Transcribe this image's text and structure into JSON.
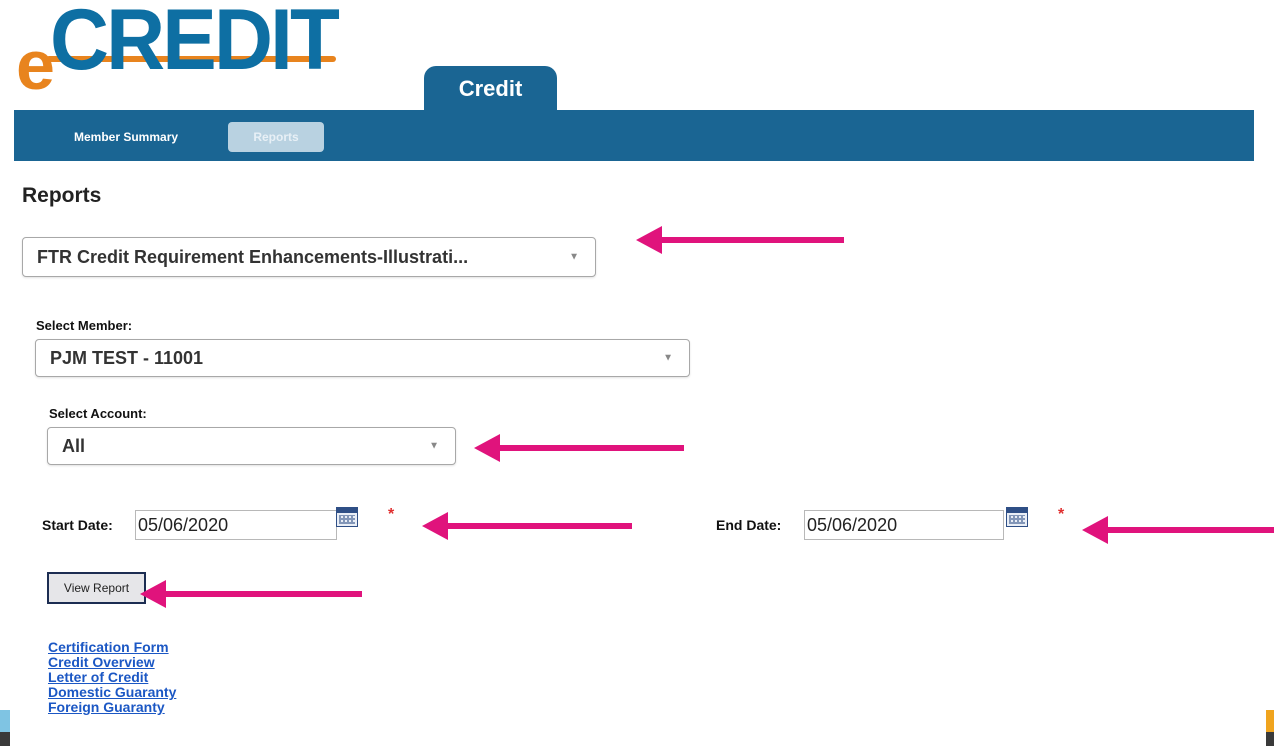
{
  "logo": {
    "prefix": "e",
    "word": "CREDIT"
  },
  "top_tab": {
    "label": "Credit"
  },
  "nav": {
    "items": [
      "Member Summary",
      "Reports"
    ],
    "active": "Reports"
  },
  "page_title": "Reports",
  "report_select": {
    "value": "FTR Credit Requirement Enhancements-Illustrati..."
  },
  "member": {
    "label": "Select Member:",
    "value": "PJM TEST - 11001"
  },
  "account": {
    "label": "Select Account:",
    "value": "All"
  },
  "start_date": {
    "label": "Start Date:",
    "value": "05/06/2020",
    "required_mark": "*"
  },
  "end_date": {
    "label": "End Date:",
    "value": "05/06/2020",
    "required_mark": "*"
  },
  "view_button": {
    "label": "View Report"
  },
  "links": [
    "Certification Form",
    "Credit Overview",
    "Letter of Credit",
    "Domestic Guaranty",
    "Foreign Guaranty"
  ],
  "colors": {
    "nav_blue": "#1a6593",
    "arrow_pink": "#e0137c",
    "logo_orange": "#e8841e",
    "link_blue": "#1b57c4"
  }
}
